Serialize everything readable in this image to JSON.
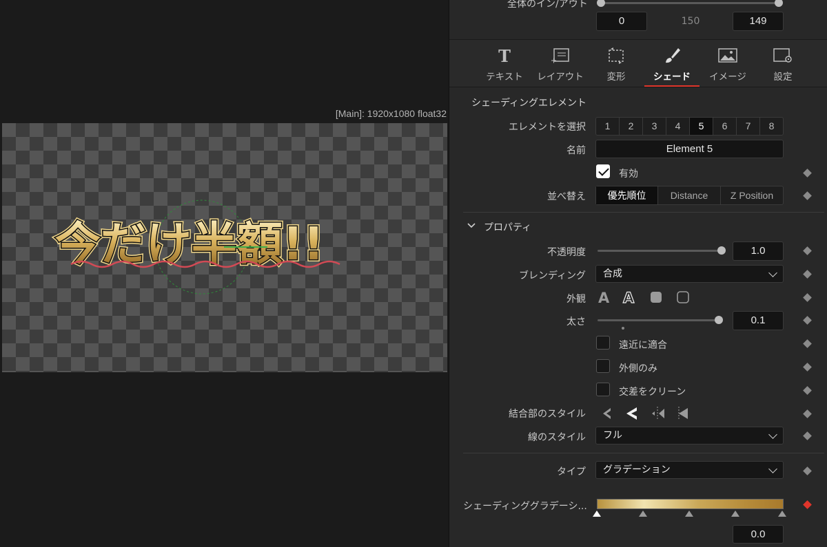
{
  "viewer": {
    "info": "[Main]: 1920x1080 float32",
    "text_overlay": "今だけ半額!!"
  },
  "io": {
    "label": "全体のイン/アウト",
    "in": "0",
    "mid": "150",
    "out": "149"
  },
  "tabs": [
    {
      "label": "テキスト",
      "icon": "text-icon"
    },
    {
      "label": "レイアウト",
      "icon": "layout-icon"
    },
    {
      "label": "変形",
      "icon": "transform-icon"
    },
    {
      "label": "シェード",
      "icon": "brush-icon",
      "active": true
    },
    {
      "label": "イメージ",
      "icon": "image-icon"
    },
    {
      "label": "設定",
      "icon": "settings-icon"
    }
  ],
  "shading": {
    "section_title": "シェーディングエレメント",
    "select_label": "エレメントを選択",
    "elements": [
      "1",
      "2",
      "3",
      "4",
      "5",
      "6",
      "7",
      "8"
    ],
    "selected_element": "5",
    "name_label": "名前",
    "name_value": "Element 5",
    "enabled_label": "有効",
    "sort_label": "並べ替え",
    "sort_options": [
      "優先順位",
      "Distance",
      "Z Position"
    ]
  },
  "properties": {
    "title": "プロパティ",
    "opacity_label": "不透明度",
    "opacity_value": "1.0",
    "opacity_level": 1.0,
    "blending_label": "ブレンディング",
    "blending_value": "合成",
    "appearance_label": "外観",
    "thickness_label": "太さ",
    "thickness_value": "0.1",
    "adapt_label": "遠近に適合",
    "outside_only_label": "外側のみ",
    "clean_label": "交差をクリーン",
    "join_style_label": "結合部のスタイル",
    "line_style_label": "線のスタイル",
    "line_style_value": "フル"
  },
  "type": {
    "label": "タイプ",
    "value": "グラデーション"
  },
  "gradient": {
    "label": "シェーディンググラデーシ...",
    "value": "0.0"
  }
}
